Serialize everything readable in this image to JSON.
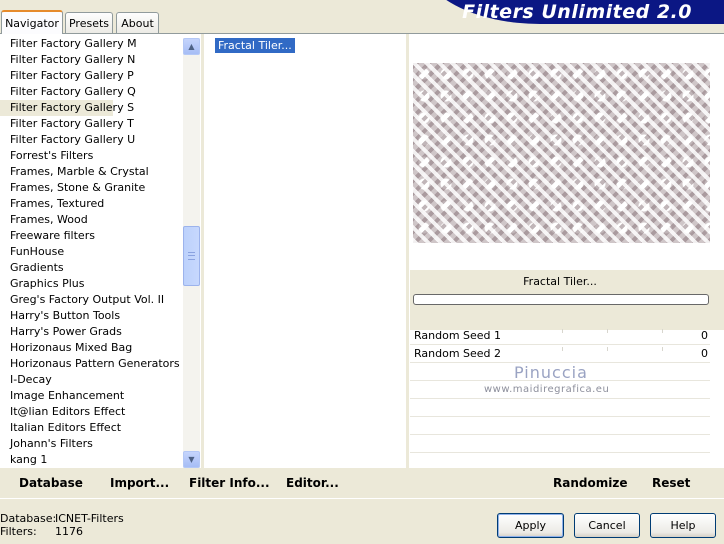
{
  "tabs": [
    {
      "label": "Navigator",
      "active": true
    },
    {
      "label": "Presets",
      "active": false
    },
    {
      "label": "About",
      "active": false
    }
  ],
  "banner_title": "Filters Unlimited 2.0",
  "categories": [
    "Filter Factory Gallery M",
    "Filter Factory Gallery N",
    "Filter Factory Gallery P",
    "Filter Factory Gallery Q",
    "Filter Factory Gallery S",
    "Filter Factory Gallery T",
    "Filter Factory Gallery U",
    "Forrest's Filters",
    "Frames, Marble & Crystal",
    "Frames, Stone & Granite",
    "Frames, Textured",
    "Frames, Wood",
    "Freeware filters",
    "FunHouse",
    "Gradients",
    "Graphics Plus",
    "Greg's Factory Output Vol. II",
    "Harry's Button Tools",
    "Harry's Power Grads",
    "Horizonaus Mixed Bag",
    "Horizonaus Pattern Generators",
    "I-Decay",
    "Image Enhancement",
    "It@lian Editors Effect",
    "Italian Editors Effect",
    "Johann's Filters",
    "kang 1"
  ],
  "selected_category": "Filter Factory Gallery S",
  "filters": [
    "Fractal Tiler..."
  ],
  "selected_filter": "Fractal Tiler...",
  "preview_filter_name": "Fractal Tiler...",
  "params": [
    {
      "name": "Random Seed 1",
      "value": "0"
    },
    {
      "name": "Random Seed 2",
      "value": "0"
    }
  ],
  "watermark": {
    "name": "Pinuccia",
    "url": "www.maidiregrafica.eu"
  },
  "actions": {
    "database": "Database",
    "import": "Import...",
    "filter_info": "Filter Info...",
    "editor": "Editor...",
    "randomize": "Randomize",
    "reset": "Reset"
  },
  "footer": {
    "database_label": "Database:",
    "database_value": "ICNET-Filters",
    "filters_label": "Filters:",
    "filters_value": "1176"
  },
  "buttons": {
    "apply": "Apply",
    "cancel": "Cancel",
    "help": "Help"
  },
  "colors": {
    "banner": "#0b1784",
    "selection": "#316ac5",
    "window_bg": "#ece9d8",
    "tab_accent": "#e68b2c"
  }
}
